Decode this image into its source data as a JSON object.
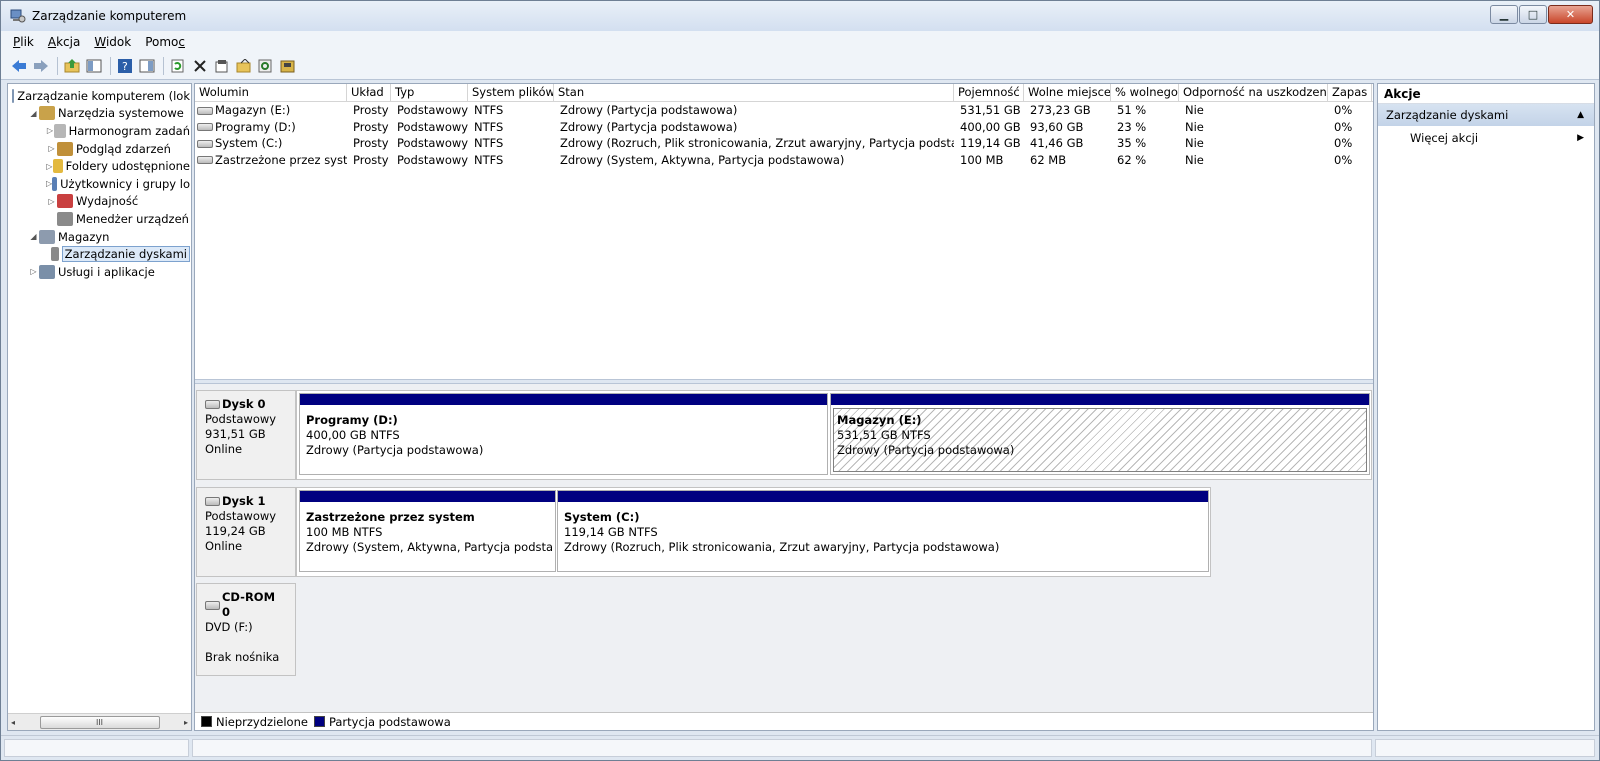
{
  "window": {
    "title": "Zarządzanie komputerem",
    "minimize": "▁",
    "maximize": "□",
    "close": "✕"
  },
  "menu": [
    "Plik",
    "Akcja",
    "Widok",
    "Pomoc"
  ],
  "menu_underline": [
    "P",
    "A",
    "W",
    "c"
  ],
  "toolbar_icons": [
    "back-arrow-icon",
    "forward-arrow-icon",
    "up-folder-icon",
    "show-hide-tree-icon",
    "help-icon",
    "show-hide-action-pane-icon",
    "refresh-icon",
    "delete-icon",
    "properties-icon",
    "open-icon",
    "search-icon",
    "disk-icon"
  ],
  "tree": [
    {
      "label": "Zarządzanie komputerem (lok",
      "level": 0,
      "arrow": "",
      "icon_color": "#7f96b3"
    },
    {
      "label": "Narzędzia systemowe",
      "level": 1,
      "arrow": "◢",
      "icon_color": "#c9a24a"
    },
    {
      "label": "Harmonogram zadań",
      "level": 2,
      "arrow": "▷",
      "icon_color": "#b6b6b6"
    },
    {
      "label": "Podgląd zdarzeń",
      "level": 2,
      "arrow": "▷",
      "icon_color": "#c0903a"
    },
    {
      "label": "Foldery udostępnione",
      "level": 2,
      "arrow": "▷",
      "icon_color": "#e3b93f"
    },
    {
      "label": "Użytkownicy i grupy lo",
      "level": 2,
      "arrow": "▷",
      "icon_color": "#5a7fb5"
    },
    {
      "label": "Wydajność",
      "level": 2,
      "arrow": "▷",
      "icon_color": "#c94040"
    },
    {
      "label": "Menedżer urządzeń",
      "level": 2,
      "arrow": "",
      "icon_color": "#8a8a8a"
    },
    {
      "label": "Magazyn",
      "level": 1,
      "arrow": "◢",
      "icon_color": "#8d9bae"
    },
    {
      "label": "Zarządzanie dyskami",
      "level": 2,
      "arrow": "",
      "icon_color": "#8a8a8a",
      "selected": true
    },
    {
      "label": "Usługi i aplikacje",
      "level": 1,
      "arrow": "▷",
      "icon_color": "#7a8fa8"
    }
  ],
  "hscroll": {
    "left": "◂",
    "thumb": "III",
    "right": "▸"
  },
  "volume_table": {
    "headers": [
      "Wolumin",
      "Układ",
      "Typ",
      "System plików",
      "Stan",
      "Pojemność",
      "Wolne miejsce",
      "% wolnego",
      "Odporność na uszkodzenia",
      "Zapas"
    ],
    "rows": [
      [
        "Magazyn (E:)",
        "Prosty",
        "Podstawowy",
        "NTFS",
        "Zdrowy (Partycja podstawowa)",
        "531,51 GB",
        "273,23 GB",
        "51 %",
        "Nie",
        "0%"
      ],
      [
        "Programy (D:)",
        "Prosty",
        "Podstawowy",
        "NTFS",
        "Zdrowy (Partycja podstawowa)",
        "400,00 GB",
        "93,60 GB",
        "23 %",
        "Nie",
        "0%"
      ],
      [
        "System (C:)",
        "Prosty",
        "Podstawowy",
        "NTFS",
        "Zdrowy (Rozruch, Plik stronicowania, Zrzut awaryjny, Partycja podstawowa)",
        "119,14 GB",
        "41,46 GB",
        "35 %",
        "Nie",
        "0%"
      ],
      [
        "Zastrzeżone przez system",
        "Prosty",
        "Podstawowy",
        "NTFS",
        "Zdrowy (System, Aktywna, Partycja podstawowa)",
        "100 MB",
        "62 MB",
        "62 %",
        "Nie",
        "0%"
      ]
    ]
  },
  "disks": [
    {
      "name": "Dysk 0",
      "type": "Podstawowy",
      "size": "931,51 GB",
      "status": "Online",
      "partitions": [
        {
          "title": "Programy  (D:)",
          "fs": "400,00 GB NTFS",
          "state": "Zdrowy (Partycja podstawowa)",
          "selected": false
        },
        {
          "title": "Magazyn  (E:)",
          "fs": "531,51 GB NTFS",
          "state": "Zdrowy (Partycja podstawowa)",
          "selected": true
        }
      ]
    },
    {
      "name": "Dysk 1",
      "type": "Podstawowy",
      "size": "119,24 GB",
      "status": "Online",
      "partitions": [
        {
          "title": "Zastrzeżone przez system",
          "fs": "100 MB NTFS",
          "state": "Zdrowy (System, Aktywna, Partycja podstawow",
          "selected": false
        },
        {
          "title": "System  (C:)",
          "fs": "119,14 GB NTFS",
          "state": "Zdrowy (Rozruch, Plik stronicowania, Zrzut awaryjny, Partycja podstawowa)",
          "selected": false
        }
      ]
    },
    {
      "name": "CD-ROM 0",
      "type": "DVD (F:)",
      "size": "",
      "status": "Brak nośnika",
      "partitions": []
    }
  ],
  "legend": [
    {
      "label": "Nieprzydzielone",
      "color": "#000000"
    },
    {
      "label": "Partycja podstawowa",
      "color": "#000080"
    }
  ],
  "actions": {
    "header": "Akcje",
    "section": "Zarządzanie dyskami",
    "section_arrow": "▲",
    "items": [
      {
        "label": "Więcej akcji",
        "arrow": "▶"
      }
    ]
  }
}
